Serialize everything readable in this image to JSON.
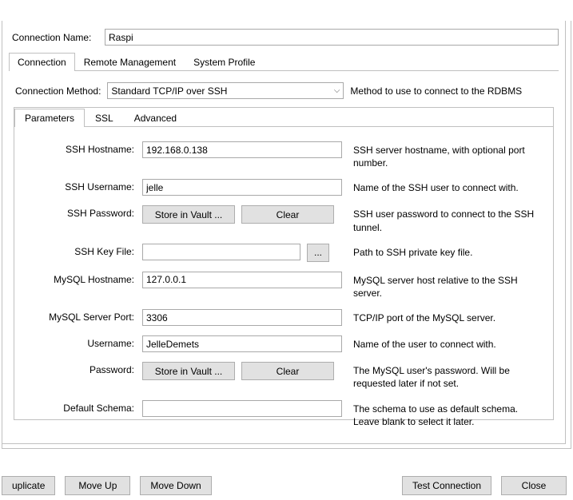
{
  "window": {
    "close_symbol": "✕"
  },
  "connectionName": {
    "label": "Connection Name:",
    "value": "Raspi"
  },
  "mainTabs": [
    "Connection",
    "Remote Management",
    "System Profile"
  ],
  "method": {
    "label": "Connection Method:",
    "value": "Standard TCP/IP over SSH",
    "hint": "Method to use to connect to the RDBMS"
  },
  "subTabs": [
    "Parameters",
    "SSL",
    "Advanced"
  ],
  "params": {
    "sshHostname": {
      "label": "SSH Hostname:",
      "value": "192.168.0.138",
      "hint": "SSH server hostname, with  optional port number."
    },
    "sshUsername": {
      "label": "SSH Username:",
      "value": "jelle",
      "hint": "Name of the SSH user to connect with."
    },
    "sshPassword": {
      "label": "SSH Password:",
      "storeBtn": "Store in Vault ...",
      "clearBtn": "Clear",
      "hint": "SSH user password to connect to the SSH tunnel."
    },
    "sshKeyFile": {
      "label": "SSH Key File:",
      "value": "",
      "browseBtn": "...",
      "hint": "Path to SSH private key file."
    },
    "mysqlHostname": {
      "label": "MySQL Hostname:",
      "value": "127.0.0.1",
      "hint": "MySQL server host relative to the SSH server."
    },
    "mysqlPort": {
      "label": "MySQL Server Port:",
      "value": "3306",
      "hint": "TCP/IP port of the MySQL server."
    },
    "username": {
      "label": "Username:",
      "value": "JelleDemets",
      "hint": "Name of the user to connect with."
    },
    "password": {
      "label": "Password:",
      "storeBtn": "Store in Vault ...",
      "clearBtn": "Clear",
      "hint": "The MySQL user's password. Will be requested later if not set."
    },
    "defaultSchema": {
      "label": "Default Schema:",
      "value": "",
      "hint": "The schema to use as default schema. Leave blank to select it later."
    }
  },
  "footer": {
    "duplicate": "uplicate",
    "moveUp": "Move Up",
    "moveDown": "Move Down",
    "testConnection": "Test Connection",
    "close": "Close"
  }
}
